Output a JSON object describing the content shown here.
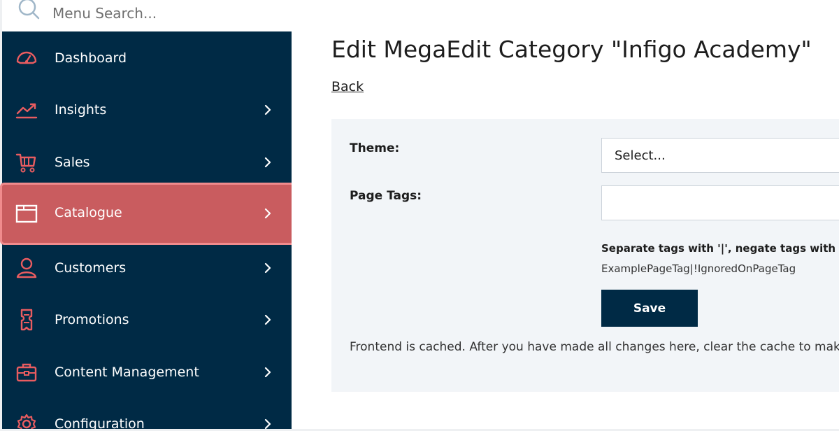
{
  "search": {
    "placeholder": "Menu Search..."
  },
  "sidebar": {
    "items": [
      {
        "label": "Dashboard",
        "icon": "dashboard-gauge-icon",
        "has_children": false
      },
      {
        "label": "Insights",
        "icon": "trend-chart-icon",
        "has_children": true
      },
      {
        "label": "Sales",
        "icon": "shopping-cart-icon",
        "has_children": true
      },
      {
        "label": "Catalogue",
        "icon": "folder-icon",
        "has_children": true,
        "active": true
      },
      {
        "label": "Customers",
        "icon": "user-icon",
        "has_children": true
      },
      {
        "label": "Promotions",
        "icon": "ticket-icon",
        "has_children": true
      },
      {
        "label": "Content Management",
        "icon": "briefcase-icon",
        "has_children": true
      },
      {
        "label": "Configuration",
        "icon": "gear-icon",
        "has_children": true
      }
    ]
  },
  "main": {
    "title": "Edit MegaEdit Category \"Infigo Academy\"",
    "back_label": "Back",
    "form": {
      "theme_label": "Theme:",
      "theme_value": "Select...",
      "page_tags_label": "Page Tags:",
      "page_tags_value": "",
      "hint_bold": "Separate tags with '|', negate tags with !:",
      "hint_example": "ExamplePageTag|!IgnoredOnPageTag",
      "save_label": "Save",
      "cache_note": "Frontend is cached. After you have made all changes here, clear the cache to make them visible."
    }
  },
  "colors": {
    "sidebar_bg": "#002a45",
    "accent": "#e95c60",
    "active_item": "#c95c5f",
    "panel_bg": "#f2f5f8"
  }
}
